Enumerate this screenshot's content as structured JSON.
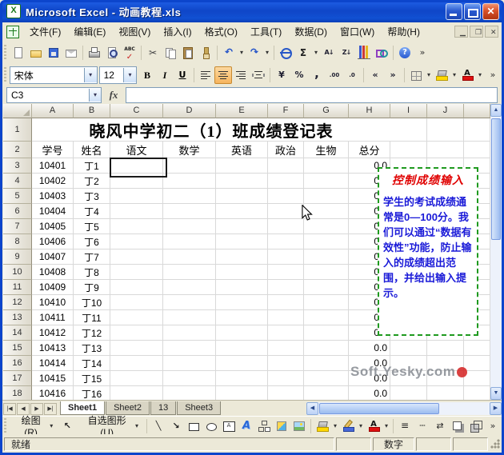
{
  "window": {
    "title": "Microsoft Excel - 动画教程.xls"
  },
  "menu_items": [
    "文件(F)",
    "编辑(E)",
    "视图(V)",
    "插入(I)",
    "格式(O)",
    "工具(T)",
    "数据(D)",
    "窗口(W)",
    "帮助(H)"
  ],
  "std_toolbar": [
    {
      "name": "new-file-icon",
      "k": "new"
    },
    {
      "name": "open-icon",
      "k": "open"
    },
    {
      "name": "save-icon",
      "k": "save"
    },
    {
      "name": "email-icon",
      "k": "mail"
    },
    {
      "name": "separator",
      "k": "sep",
      "inter": "false"
    },
    {
      "name": "print-icon",
      "k": "print"
    },
    {
      "name": "print-preview-icon",
      "k": "preview"
    },
    {
      "name": "spelling-icon",
      "k": "spell"
    },
    {
      "name": "separator",
      "k": "sep",
      "inter": "false"
    },
    {
      "name": "cut-icon",
      "k": "cut"
    },
    {
      "name": "copy-icon",
      "k": "copy"
    },
    {
      "name": "paste-icon",
      "k": "paste"
    },
    {
      "name": "format-painter-icon",
      "k": "painter"
    },
    {
      "name": "separator",
      "k": "sep",
      "inter": "false"
    },
    {
      "name": "undo-icon",
      "k": "undo"
    },
    {
      "name": "undo-dropdown",
      "k": "dd"
    },
    {
      "name": "redo-icon",
      "k": "redo"
    },
    {
      "name": "redo-dropdown",
      "k": "dd"
    },
    {
      "name": "separator",
      "k": "sep",
      "inter": "false"
    },
    {
      "name": "hyperlink-icon",
      "k": "link"
    },
    {
      "name": "autosum-icon",
      "k": "sum"
    },
    {
      "name": "autosum-dropdown",
      "k": "dd"
    },
    {
      "name": "sort-ascending-icon",
      "k": "sortaz"
    },
    {
      "name": "sort-descending-icon",
      "k": "sortza"
    },
    {
      "name": "chart-wizard-icon",
      "k": "chart"
    },
    {
      "name": "drawing-icon",
      "k": "draw"
    },
    {
      "name": "separator",
      "k": "sep",
      "inter": "false"
    },
    {
      "name": "help-icon",
      "k": "help"
    },
    {
      "name": "toolbar-options-icon",
      "k": "more"
    }
  ],
  "formatting": {
    "font_name": "宋体",
    "font_size": "12",
    "buttons": [
      {
        "name": "bold-icon",
        "k": "bold"
      },
      {
        "name": "italic-icon",
        "k": "italic"
      },
      {
        "name": "underline-icon",
        "k": "underline"
      },
      {
        "name": "separator",
        "k": "sep",
        "inter": "false"
      },
      {
        "name": "align-left-icon",
        "k": "alignl"
      },
      {
        "name": "align-center-icon",
        "k": "alignc",
        "active": "true"
      },
      {
        "name": "align-right-icon",
        "k": "alignr"
      },
      {
        "name": "merge-center-icon",
        "k": "merge"
      },
      {
        "name": "separator",
        "k": "sep",
        "inter": "false"
      },
      {
        "name": "currency-icon",
        "k": "currency"
      },
      {
        "name": "percent-icon",
        "k": "percent"
      },
      {
        "name": "comma-icon",
        "k": "comma"
      },
      {
        "name": "increase-decimal-icon",
        "k": "incdec"
      },
      {
        "name": "decrease-decimal-icon",
        "k": "decdec"
      },
      {
        "name": "separator",
        "k": "sep",
        "inter": "false"
      },
      {
        "name": "decrease-indent-icon",
        "k": "outdent"
      },
      {
        "name": "increase-indent-icon",
        "k": "indent"
      },
      {
        "name": "separator",
        "k": "sep",
        "inter": "false"
      },
      {
        "name": "borders-icon",
        "k": "borders"
      },
      {
        "name": "borders-dropdown",
        "k": "dd"
      },
      {
        "name": "fill-color-icon",
        "k": "fill"
      },
      {
        "name": "fill-color-dropdown",
        "k": "dd"
      },
      {
        "name": "font-color-icon",
        "k": "fontcolor"
      },
      {
        "name": "font-color-dropdown",
        "k": "dd"
      },
      {
        "name": "toolbar-options-icon",
        "k": "more"
      }
    ]
  },
  "formula_bar": {
    "name_box": "C3",
    "fx_label": "fx",
    "formula": ""
  },
  "grid": {
    "columns": [
      "A",
      "B",
      "C",
      "D",
      "E",
      "F",
      "G",
      "H",
      "I",
      "J"
    ],
    "title_row": {
      "num": "1",
      "text": "晓风中学初二（1）班成绩登记表"
    },
    "header_row": {
      "num": "2",
      "cells": [
        "学号",
        "姓名",
        "语文",
        "数学",
        "英语",
        "政治",
        "生物",
        "总分"
      ]
    },
    "students": [
      {
        "num": "3",
        "id": "10401",
        "name": "丁1",
        "total": "0.0"
      },
      {
        "num": "4",
        "id": "10402",
        "name": "丁2",
        "total": "0.0"
      },
      {
        "num": "5",
        "id": "10403",
        "name": "丁3",
        "total": "0.0"
      },
      {
        "num": "6",
        "id": "10404",
        "name": "丁4",
        "total": "0.0"
      },
      {
        "num": "7",
        "id": "10405",
        "name": "丁5",
        "total": "0.0"
      },
      {
        "num": "8",
        "id": "10406",
        "name": "丁6",
        "total": "0.0"
      },
      {
        "num": "9",
        "id": "10407",
        "name": "丁7",
        "total": "0.0"
      },
      {
        "num": "10",
        "id": "10408",
        "name": "丁8",
        "total": "0.0"
      },
      {
        "num": "11",
        "id": "10409",
        "name": "丁9",
        "total": "0.0"
      },
      {
        "num": "12",
        "id": "10410",
        "name": "丁10",
        "total": "0.0"
      },
      {
        "num": "13",
        "id": "10411",
        "name": "丁11",
        "total": "0.0"
      },
      {
        "num": "14",
        "id": "10412",
        "name": "丁12",
        "total": "0.0"
      },
      {
        "num": "15",
        "id": "10413",
        "name": "丁13",
        "total": "0.0"
      },
      {
        "num": "16",
        "id": "10414",
        "name": "丁14",
        "total": "0.0"
      },
      {
        "num": "17",
        "id": "10415",
        "name": "丁15",
        "total": "0.0"
      },
      {
        "num": "18",
        "id": "10416",
        "name": "丁16",
        "total": "0.0"
      }
    ]
  },
  "comment": {
    "title": "控制成绩输入",
    "body": "学生的考试成绩通常是0—100分。我们可以通过“数据有效性”功能，防止输入的成绩超出范围，并给出输入提示。"
  },
  "tabs": {
    "items": [
      {
        "label": "Sheet1",
        "active": "true"
      },
      {
        "label": "Sheet2",
        "active": "false"
      },
      {
        "label": "13",
        "active": "false"
      },
      {
        "label": "Sheet3",
        "active": "false"
      }
    ]
  },
  "draw_toolbar": {
    "draw_label": "绘图(R)",
    "autoshapes_label": "自选图形(U)",
    "left_icons": [
      {
        "name": "select-objects-icon",
        "k": "selarrow"
      }
    ],
    "icons": [
      {
        "name": "separator",
        "k": "sep",
        "inter": "false"
      },
      {
        "name": "line-icon",
        "k": "line"
      },
      {
        "name": "arrow-icon",
        "k": "arrow"
      },
      {
        "name": "rectangle-icon",
        "k": "rect"
      },
      {
        "name": "oval-icon",
        "k": "oval"
      },
      {
        "name": "text-box-icon",
        "k": "textbox"
      },
      {
        "name": "wordart-icon",
        "k": "wordart"
      },
      {
        "name": "diagram-icon",
        "k": "diagram"
      },
      {
        "name": "clip-art-icon",
        "k": "clipart"
      },
      {
        "name": "picture-icon",
        "k": "picture"
      },
      {
        "name": "separator",
        "k": "sep",
        "inter": "false"
      },
      {
        "name": "fill-color-icon",
        "k": "fill"
      },
      {
        "name": "fill-color-dropdown",
        "k": "dd"
      },
      {
        "name": "line-color-icon",
        "k": "linecolor"
      },
      {
        "name": "line-color-dropdown",
        "k": "dd"
      },
      {
        "name": "font-color-icon",
        "k": "fontcolor"
      },
      {
        "name": "font-color-dropdown",
        "k": "dd"
      },
      {
        "name": "separator",
        "k": "sep",
        "inter": "false"
      },
      {
        "name": "line-style-icon",
        "k": "linestyle"
      },
      {
        "name": "dash-style-icon",
        "k": "dash"
      },
      {
        "name": "arrow-style-icon",
        "k": "arrowstyle"
      },
      {
        "name": "shadow-style-icon",
        "k": "shadow"
      },
      {
        "name": "3d-style-icon",
        "k": "threed"
      },
      {
        "name": "toolbar-options-icon",
        "k": "more"
      }
    ]
  },
  "status": {
    "ready": "就绪",
    "num_lock": "数字"
  },
  "watermark": {
    "text": "Soft.Yesky.com"
  }
}
